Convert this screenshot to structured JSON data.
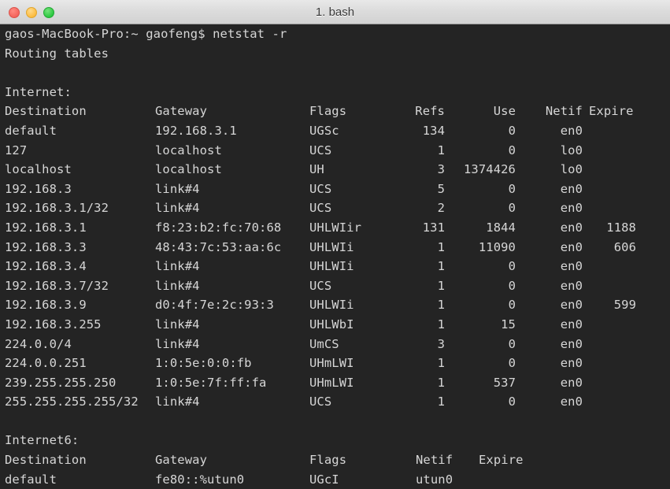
{
  "window": {
    "title": "1. bash",
    "traffic_lights": [
      {
        "name": "close",
        "color": "#f4645c"
      },
      {
        "name": "minimize",
        "color": "#fcbc40"
      },
      {
        "name": "maximize",
        "color": "#2bc840"
      }
    ],
    "background": "#242424",
    "foreground": "#d6d6d6"
  },
  "terminal": {
    "prompt_line": "gaos-MacBook-Pro:~ gaofeng$ netstat -r",
    "routing_tables_label": "Routing tables",
    "internet_label": "Internet:",
    "internet6_label": "Internet6:",
    "headers": {
      "destination": "Destination",
      "gateway": "Gateway",
      "flags": "Flags",
      "refs": "Refs",
      "use": "Use",
      "netif": "Netif",
      "expire": "Expire"
    },
    "internet_rows": [
      {
        "destination": "default",
        "gateway": "192.168.3.1",
        "flags": "UGSc",
        "refs": "134",
        "use": "0",
        "netif": "en0",
        "expire": ""
      },
      {
        "destination": "127",
        "gateway": "localhost",
        "flags": "UCS",
        "refs": "1",
        "use": "0",
        "netif": "lo0",
        "expire": ""
      },
      {
        "destination": "localhost",
        "gateway": "localhost",
        "flags": "UH",
        "refs": "3",
        "use": "1374426",
        "netif": "lo0",
        "expire": ""
      },
      {
        "destination": "192.168.3",
        "gateway": "link#4",
        "flags": "UCS",
        "refs": "5",
        "use": "0",
        "netif": "en0",
        "expire": ""
      },
      {
        "destination": "192.168.3.1/32",
        "gateway": "link#4",
        "flags": "UCS",
        "refs": "2",
        "use": "0",
        "netif": "en0",
        "expire": ""
      },
      {
        "destination": "192.168.3.1",
        "gateway": "f8:23:b2:fc:70:68",
        "flags": "UHLWIir",
        "refs": "131",
        "use": "1844",
        "netif": "en0",
        "expire": "1188"
      },
      {
        "destination": "192.168.3.3",
        "gateway": "48:43:7c:53:aa:6c",
        "flags": "UHLWIi",
        "refs": "1",
        "use": "11090",
        "netif": "en0",
        "expire": "606"
      },
      {
        "destination": "192.168.3.4",
        "gateway": "link#4",
        "flags": "UHLWIi",
        "refs": "1",
        "use": "0",
        "netif": "en0",
        "expire": ""
      },
      {
        "destination": "192.168.3.7/32",
        "gateway": "link#4",
        "flags": "UCS",
        "refs": "1",
        "use": "0",
        "netif": "en0",
        "expire": ""
      },
      {
        "destination": "192.168.3.9",
        "gateway": "d0:4f:7e:2c:93:3",
        "flags": "UHLWIi",
        "refs": "1",
        "use": "0",
        "netif": "en0",
        "expire": "599"
      },
      {
        "destination": "192.168.3.255",
        "gateway": "link#4",
        "flags": "UHLWbI",
        "refs": "1",
        "use": "15",
        "netif": "en0",
        "expire": ""
      },
      {
        "destination": "224.0.0/4",
        "gateway": "link#4",
        "flags": "UmCS",
        "refs": "3",
        "use": "0",
        "netif": "en0",
        "expire": ""
      },
      {
        "destination": "224.0.0.251",
        "gateway": "1:0:5e:0:0:fb",
        "flags": "UHmLWI",
        "refs": "1",
        "use": "0",
        "netif": "en0",
        "expire": ""
      },
      {
        "destination": "239.255.255.250",
        "gateway": "1:0:5e:7f:ff:fa",
        "flags": "UHmLWI",
        "refs": "1",
        "use": "537",
        "netif": "en0",
        "expire": ""
      },
      {
        "destination": "255.255.255.255/32",
        "gateway": "link#4",
        "flags": "UCS",
        "refs": "1",
        "use": "0",
        "netif": "en0",
        "expire": ""
      }
    ],
    "internet6_rows": [
      {
        "destination": "default",
        "gateway": "fe80::%utun0",
        "flags": "UGcI",
        "netif": "utun0",
        "expire": ""
      }
    ]
  }
}
